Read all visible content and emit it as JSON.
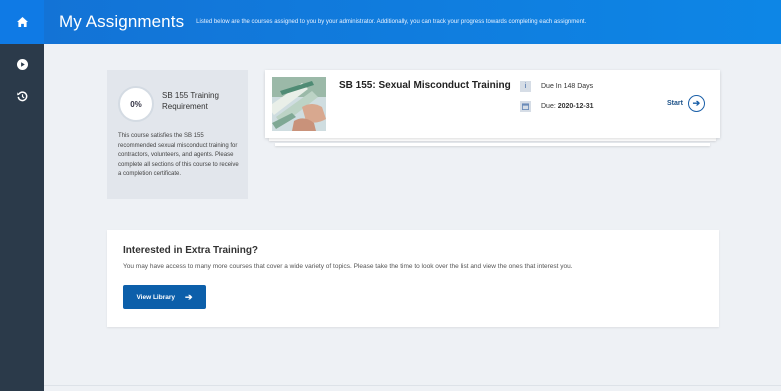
{
  "header": {
    "title": "My Assignments",
    "description": "Listed below are the courses assigned to you by your administrator. Additionally, you can track your progress towards completing each assignment."
  },
  "sidebar": {
    "items": [
      {
        "icon": "home-icon"
      },
      {
        "icon": "play-icon"
      },
      {
        "icon": "history-icon"
      }
    ]
  },
  "requirement": {
    "progress": "0%",
    "title": "SB 155 Training Requirement",
    "description": "This course satisfies the SB 155 recommended sexual misconduct training for contractors, volunteers, and agents. Please complete all sections of this course to receive a completion certificate."
  },
  "course": {
    "title": "SB 155: Sexual Misconduct Training",
    "due_in": "Due In 148 Days",
    "due_date_prefix": "Due: ",
    "due_date": "2020-12-31",
    "start_label": "Start",
    "info_icon_glyph": "i"
  },
  "extra": {
    "title": "Interested in Extra Training?",
    "description": "You may have access to many more courses that cover a wide variety of topics. Please take the time to look over the list and view the ones that interest you.",
    "button_label": "View Library"
  },
  "colors": {
    "accent": "#0f7ae5",
    "sidebar": "#2b3a4a",
    "button": "#0c5faa"
  }
}
